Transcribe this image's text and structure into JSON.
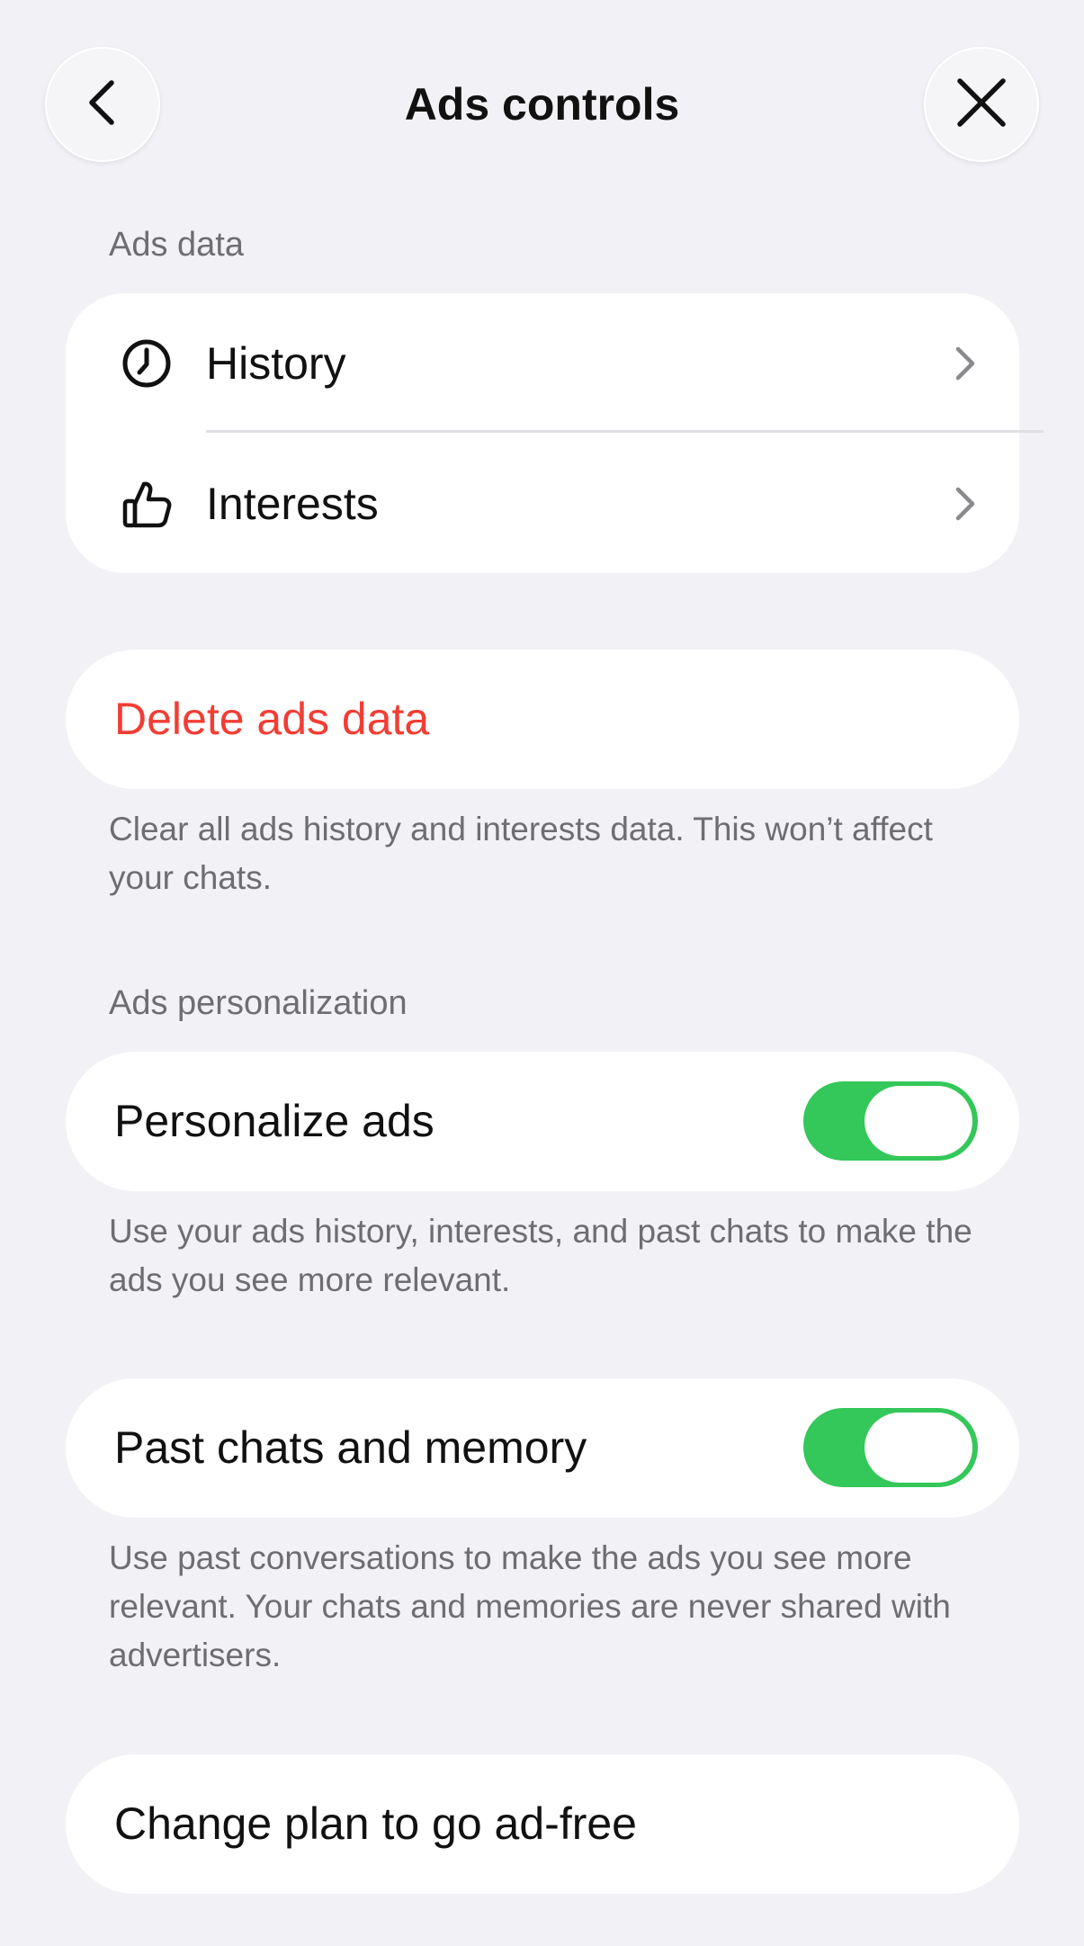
{
  "header": {
    "title": "Ads controls",
    "back_icon": "chevron-left-icon",
    "close_icon": "close-icon"
  },
  "ads_data": {
    "section_label": "Ads data",
    "items": [
      {
        "label": "History",
        "icon": "clock-icon"
      },
      {
        "label": "Interests",
        "icon": "thumbs-up-icon"
      }
    ]
  },
  "delete": {
    "label": "Delete ads data",
    "description": "Clear all ads history and interests data. This won’t affect your chats.",
    "color": "#f23d34"
  },
  "personalization": {
    "section_label": "Ads personalization",
    "personalize": {
      "label": "Personalize ads",
      "enabled": true,
      "description": "Use your ads history, interests, and past chats to make the ads you see more relevant."
    },
    "past_chats": {
      "label": "Past chats and memory",
      "enabled": true,
      "description": "Use past conversations to make the ads you see more relevant. Your chats and memories are never shared with advertisers."
    },
    "toggle_color": "#34c759"
  },
  "plan": {
    "label": "Change plan to go ad-free"
  }
}
